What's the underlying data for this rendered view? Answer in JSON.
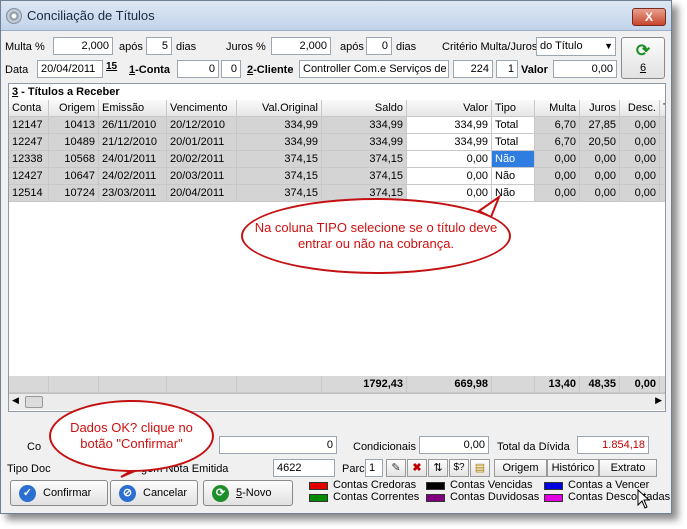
{
  "window": {
    "title": "Conciliação de Títulos",
    "close_label": "X"
  },
  "filters": {
    "multa_label": "Multa %",
    "multa_value": "2,000",
    "apos1_label": "após",
    "apos1_value": "5",
    "dias1_label": "dias",
    "juros_label": "Juros %",
    "juros_value": "2,000",
    "apos2_label": "após",
    "apos2_value": "0",
    "dias2_label": "dias",
    "criterio_label": "Critério Multa/Juros",
    "criterio_value": "do Título",
    "data_label": "Data",
    "data_value": "20/04/2011",
    "cal_label": "15",
    "conta_num": "1",
    "conta_label": "-Conta",
    "conta_value1": "0",
    "conta_value2": "0",
    "cliente_num": "2",
    "cliente_label": "-Cliente",
    "cliente_value": "Controller Com.e Serviços de F",
    "cliente_code": "224",
    "cliente_seq": "1",
    "valor_label": "Valor",
    "valor_value": "0,00",
    "refresh_num": "6"
  },
  "grid": {
    "caption_num": "3",
    "caption": " - Títulos a Receber",
    "headers": [
      "Conta",
      "Origem",
      "Emissão",
      "Vencimento",
      "Val.Original",
      "Saldo",
      "Valor",
      "Tipo",
      "Multa",
      "Juros",
      "Desc.",
      "T"
    ],
    "rows": [
      [
        "12147",
        "10413",
        "26/11/2010",
        "20/12/2010",
        "334,99",
        "334,99",
        "334,99",
        "Total",
        "6,70",
        "27,85",
        "0,00"
      ],
      [
        "12247",
        "10489",
        "21/12/2010",
        "20/01/2011",
        "334,99",
        "334,99",
        "334,99",
        "Total",
        "6,70",
        "20,50",
        "0,00"
      ],
      [
        "12338",
        "10568",
        "24/01/2011",
        "20/02/2011",
        "374,15",
        "374,15",
        "0,00",
        "Não",
        "0,00",
        "0,00",
        "0,00"
      ],
      [
        "12427",
        "10647",
        "24/02/2011",
        "20/03/2011",
        "374,15",
        "374,15",
        "0,00",
        "Não",
        "0,00",
        "0,00",
        "0,00"
      ],
      [
        "12514",
        "10724",
        "23/03/2011",
        "20/04/2011",
        "374,15",
        "374,15",
        "0,00",
        "Não",
        "0,00",
        "0,00",
        "0,00"
      ]
    ],
    "totals": {
      "saldo": "1792,43",
      "valor": "669,98",
      "multa": "13,40",
      "juros": "48,35",
      "desc": "0,00"
    }
  },
  "summary": {
    "left_label": "Co",
    "left_value": "0",
    "condicionais_label": "Condicionais",
    "condicionais_value": "0,00",
    "total_label": "Total da Dívida",
    "total_value": "1.854,18",
    "tipodoc_label": "Tipo Doc",
    "nota_label": "gem Nota Emitida",
    "nota_value": "4622",
    "parc_label": "Parc",
    "parc_value": "1"
  },
  "tabs": [
    "Origem",
    "Histórico",
    "Extrato"
  ],
  "icon_buttons": [
    "edit-icon",
    "delete-icon",
    "sort-icon",
    "help-icon",
    "folder-icon"
  ],
  "icon_glyphs": {
    "edit": "✎",
    "delete": "✖",
    "sort": "⇅",
    "help": "$?",
    "folder": "▤"
  },
  "buttons": {
    "confirmar": "Confirmar",
    "cancelar": "Cancelar",
    "novo_num": "5",
    "novo": "-Novo"
  },
  "legend": [
    {
      "label": "Contas Credoras",
      "color": "#e00000"
    },
    {
      "label": "Contas Vencidas",
      "color": "#000000"
    },
    {
      "label": "Contas a Vencer",
      "color": "#0000e0"
    },
    {
      "label": "Contas Correntes",
      "color": "#008a00"
    },
    {
      "label": "Contas Duvidosas",
      "color": "#800080"
    },
    {
      "label": "Contas Descontadas",
      "color": "#e000e0"
    }
  ],
  "callouts": {
    "tipo": "Na coluna TIPO selecione se o título deve entrar ou não na cobrança.",
    "confirmar": "Dados OK? clique no botão \"Confirmar\""
  }
}
